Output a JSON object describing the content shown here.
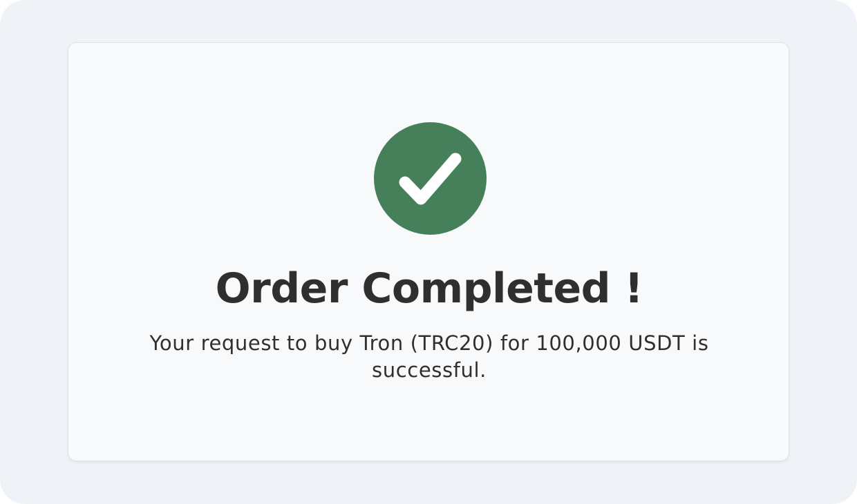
{
  "dialog": {
    "status_icon": "check-circle-icon",
    "title": "Order Completed !",
    "message": "Your request to buy Tron (TRC20) for 100,000 USDT is successful."
  },
  "colors": {
    "success": "#46805a",
    "text": "#2f2f30",
    "card_background": "#f8f9fb",
    "page_background": "#eff2f6"
  }
}
